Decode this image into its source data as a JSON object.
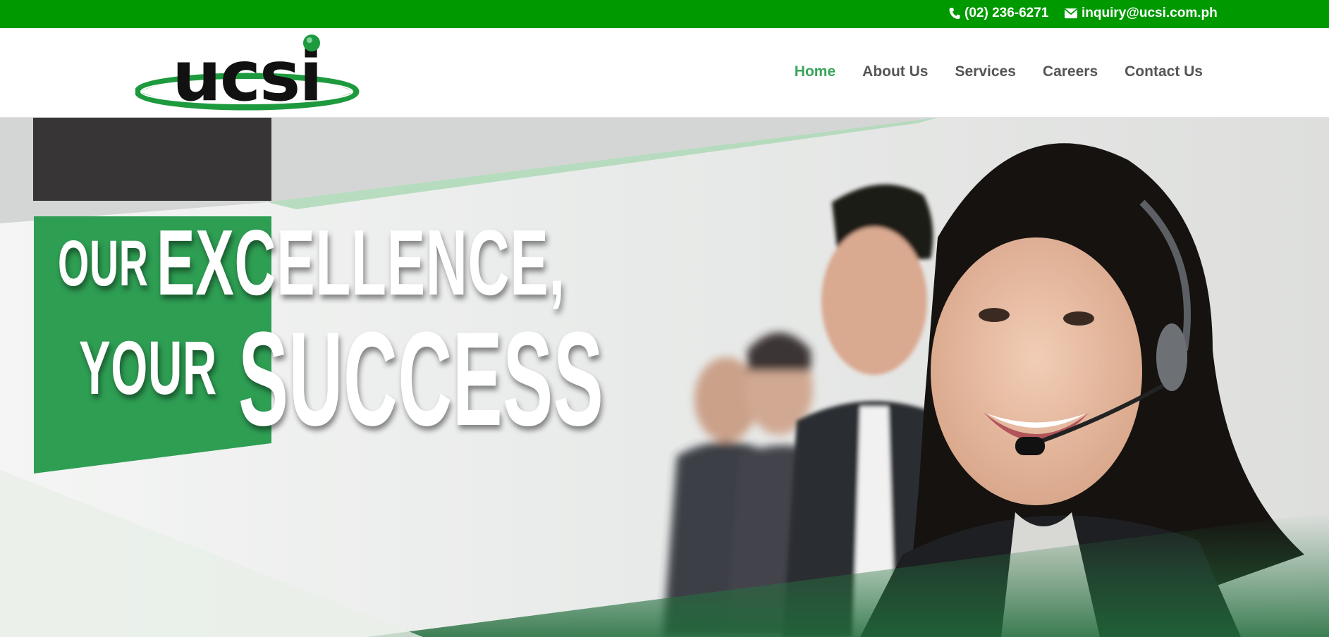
{
  "topbar": {
    "phone": "(02) 236-6271",
    "email": "inquiry@ucsi.com.ph",
    "phone_icon": "phone-icon",
    "email_icon": "envelope-icon"
  },
  "logo": {
    "text": "ucsi"
  },
  "nav": {
    "home": "Home",
    "about": "About Us",
    "services": "Services",
    "careers": "Careers",
    "contact": "Contact Us"
  },
  "hero": {
    "line1_a": "OUR",
    "line1_b": "EXCELLENCE,",
    "line2_a": "YOUR",
    "line2_b": "SUCCESS"
  },
  "colors": {
    "topbar": "#009900",
    "accent_green": "#2e9e53",
    "nav_active": "#3aa55a",
    "nav_text": "#555555",
    "dark_block": "#383537"
  }
}
